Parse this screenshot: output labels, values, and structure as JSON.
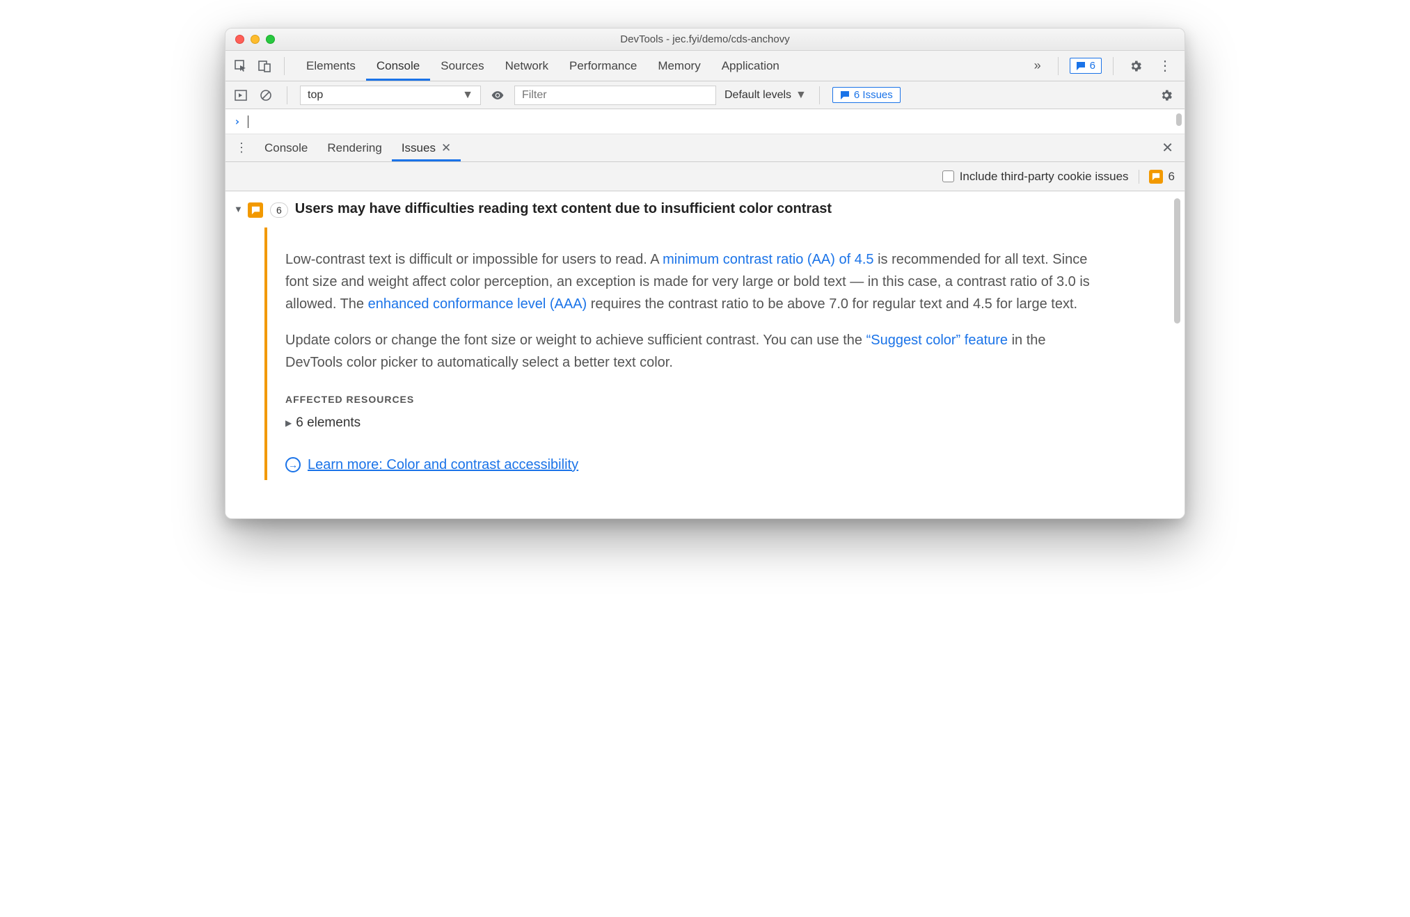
{
  "window": {
    "title": "DevTools - jec.fyi/demo/cds-anchovy"
  },
  "mainTabs": {
    "items": [
      "Elements",
      "Console",
      "Sources",
      "Network",
      "Performance",
      "Memory",
      "Application"
    ],
    "activeIndex": 1,
    "moreGlyph": "»",
    "issuesBadge": "6"
  },
  "consoleBar": {
    "contextLabel": "top",
    "filterPlaceholder": "Filter",
    "levelsLabel": "Default levels",
    "issuesLabel": "6 Issues"
  },
  "drawer": {
    "tabs": [
      "Console",
      "Rendering",
      "Issues"
    ],
    "activeIndex": 2
  },
  "issuesBar": {
    "checkboxLabel": "Include third-party cookie issues",
    "count": "6"
  },
  "issue": {
    "count": "6",
    "title": "Users may have difficulties reading text content due to insufficient color contrast",
    "p1_a": "Low-contrast text is difficult or impossible for users to read. A ",
    "p1_link1": "minimum contrast ratio (AA) of 4.5",
    "p1_b": " is recommended for all text. Since font size and weight affect color perception, an exception is made for very large or bold text — in this case, a contrast ratio of 3.0 is allowed. The ",
    "p1_link2": "enhanced conformance level (AAA)",
    "p1_c": " requires the contrast ratio to be above 7.0 for regular text and 4.5 for large text.",
    "p2_a": "Update colors or change the font size or weight to achieve sufficient contrast. You can use the ",
    "p2_link": "“Suggest color” feature",
    "p2_b": " in the DevTools color picker to automatically select a better text color.",
    "affectedHeading": "AFFECTED RESOURCES",
    "affectedItem": "6 elements",
    "learnMore": "Learn more: Color and contrast accessibility"
  }
}
